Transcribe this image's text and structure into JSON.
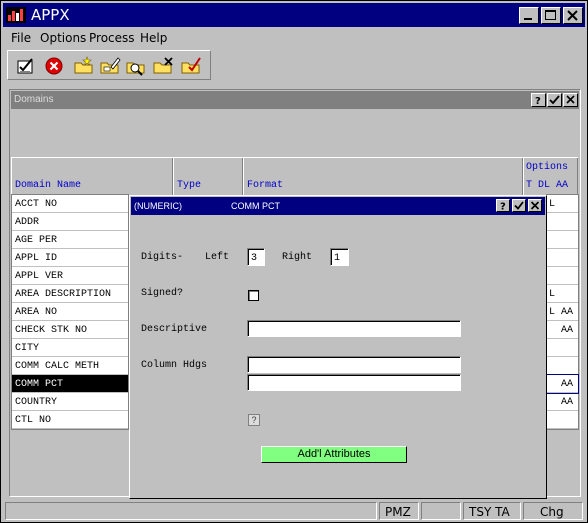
{
  "app": {
    "title": "APPX"
  },
  "menu": [
    {
      "label": "File"
    },
    {
      "label": "Options"
    },
    {
      "label": "Process"
    },
    {
      "label": "Help"
    }
  ],
  "toolbar": {
    "icons": [
      "checklist-icon",
      "cancel-icon",
      "folder-star-icon",
      "folder-edit-icon",
      "folder-search-icon",
      "folder-delete-icon",
      "folder-check-icon"
    ]
  },
  "panel": {
    "title": "Domains"
  },
  "columns": {
    "domain_name": "Domain Name",
    "type": "Type",
    "format": "Format",
    "options": "Options",
    "options_sub": "T DL AA"
  },
  "domains": [
    "ACCT NO",
    "ADDR",
    "AGE PER",
    "APPL ID",
    "APPL VER",
    "AREA DESCRIPTION",
    "AREA NO",
    "CHECK STK NO",
    "CITY",
    "COMM CALC METH",
    "COMM PCT",
    "COUNTRY",
    "CTL NO"
  ],
  "selected_domain": "COMM PCT",
  "options_values": [
    "L",
    "",
    "",
    "",
    "",
    "L",
    "L AA",
    "  AA",
    "",
    "",
    "  AA",
    "  AA",
    ""
  ],
  "dialog": {
    "type": "(NUMERIC)",
    "name": "COMM PCT",
    "digits_label": "Digits-",
    "left_label": "Left",
    "left_value": "3",
    "right_label": "Right",
    "right_value": "1",
    "signed_label": "Signed?",
    "descriptive_label": "Descriptive",
    "descriptive_value": "",
    "column_hdgs_label": "Column Hdgs",
    "column_hdg_1": "",
    "column_hdg_2": "",
    "help_mark": "?",
    "attributes_button": "Add'l Attributes"
  },
  "status": {
    "seg1": "",
    "seg2": "PMZ",
    "seg3": "",
    "seg4": "TSY TA",
    "seg5": "Chg"
  },
  "colors": {
    "title_active": "#000080",
    "title_inactive": "#808080",
    "attr_button": "#80ff80",
    "header_text": "#0000c8"
  }
}
